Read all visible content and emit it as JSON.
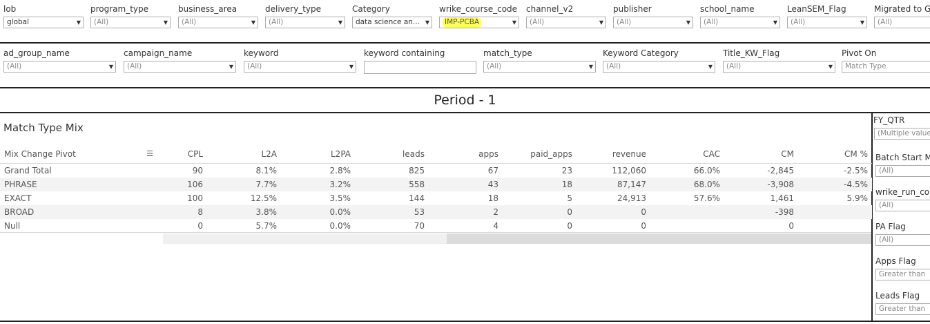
{
  "filters_row1": [
    {
      "label": "lob",
      "value": "global"
    },
    {
      "label": "program_type",
      "value": "(All)"
    },
    {
      "label": "business_area",
      "value": "(All)"
    },
    {
      "label": "delivery_type",
      "value": "(All)"
    },
    {
      "label": "Category",
      "value": "data science an..."
    },
    {
      "label": "wrike_course_code",
      "value": "IMP-PCBA"
    },
    {
      "label": "channel_v2",
      "value": "(All)"
    },
    {
      "label": "publisher",
      "value": "(All)"
    },
    {
      "label": "school_name",
      "value": "(All)"
    },
    {
      "label": "LeanSEM_Flag",
      "value": "(All)"
    },
    {
      "label": "Migrated to G",
      "value": "(All)"
    }
  ],
  "filters_row2": [
    {
      "label": "ad_group_name",
      "value": "(All)"
    },
    {
      "label": "campaign_name",
      "value": "(All)"
    },
    {
      "label": "keyword",
      "value": "(All)"
    },
    {
      "label": "keyword containing",
      "value": ""
    },
    {
      "label": "match_type",
      "value": "(All)"
    },
    {
      "label": "Keyword Category",
      "value": "(All)"
    },
    {
      "label": "Title_KW_Flag",
      "value": "(All)"
    },
    {
      "label": "Pivot On",
      "value": "Match Type"
    }
  ],
  "period_title": "Period - 1",
  "section_title": "Match Type Mix",
  "table": {
    "columns": [
      "Mix Change Pivot",
      "CPL",
      "L2A",
      "L2PA",
      "leads",
      "apps",
      "paid_apps",
      "revenue",
      "CAC",
      "CM",
      "CM %"
    ],
    "rows": [
      [
        "Grand Total",
        "90",
        "8.1%",
        "2.8%",
        "825",
        "67",
        "23",
        "112,060",
        "66.0%",
        "-2,845",
        "-2.5%"
      ],
      [
        "PHRASE",
        "106",
        "7.7%",
        "3.2%",
        "558",
        "43",
        "18",
        "87,147",
        "68.0%",
        "-3,908",
        "-4.5%"
      ],
      [
        "EXACT",
        "100",
        "12.5%",
        "3.5%",
        "144",
        "18",
        "5",
        "24,913",
        "57.6%",
        "1,461",
        "5.9%"
      ],
      [
        "BROAD",
        "8",
        "3.8%",
        "0.0%",
        "53",
        "2",
        "0",
        "0",
        "",
        "-398",
        ""
      ],
      [
        "Null",
        "0",
        "5.7%",
        "0.0%",
        "70",
        "4",
        "0",
        "0",
        "",
        "0",
        ""
      ]
    ]
  },
  "side_filters": [
    {
      "label": "FY_QTR",
      "value": "(Multiple values)"
    },
    {
      "label": "Batch Start M",
      "value": "(All)"
    },
    {
      "label": "wrike_run_co",
      "value": "(All)"
    },
    {
      "label": "PA Flag",
      "value": "(All)"
    },
    {
      "label": "Apps Flag",
      "value": "Greater than"
    },
    {
      "label": "Leads Flag",
      "value": "Greater than"
    }
  ],
  "icons": {
    "dropdown": "dropdown-arrow-icon",
    "sort": "sort-icon"
  },
  "colors": {
    "highlight": "#ffff55"
  }
}
